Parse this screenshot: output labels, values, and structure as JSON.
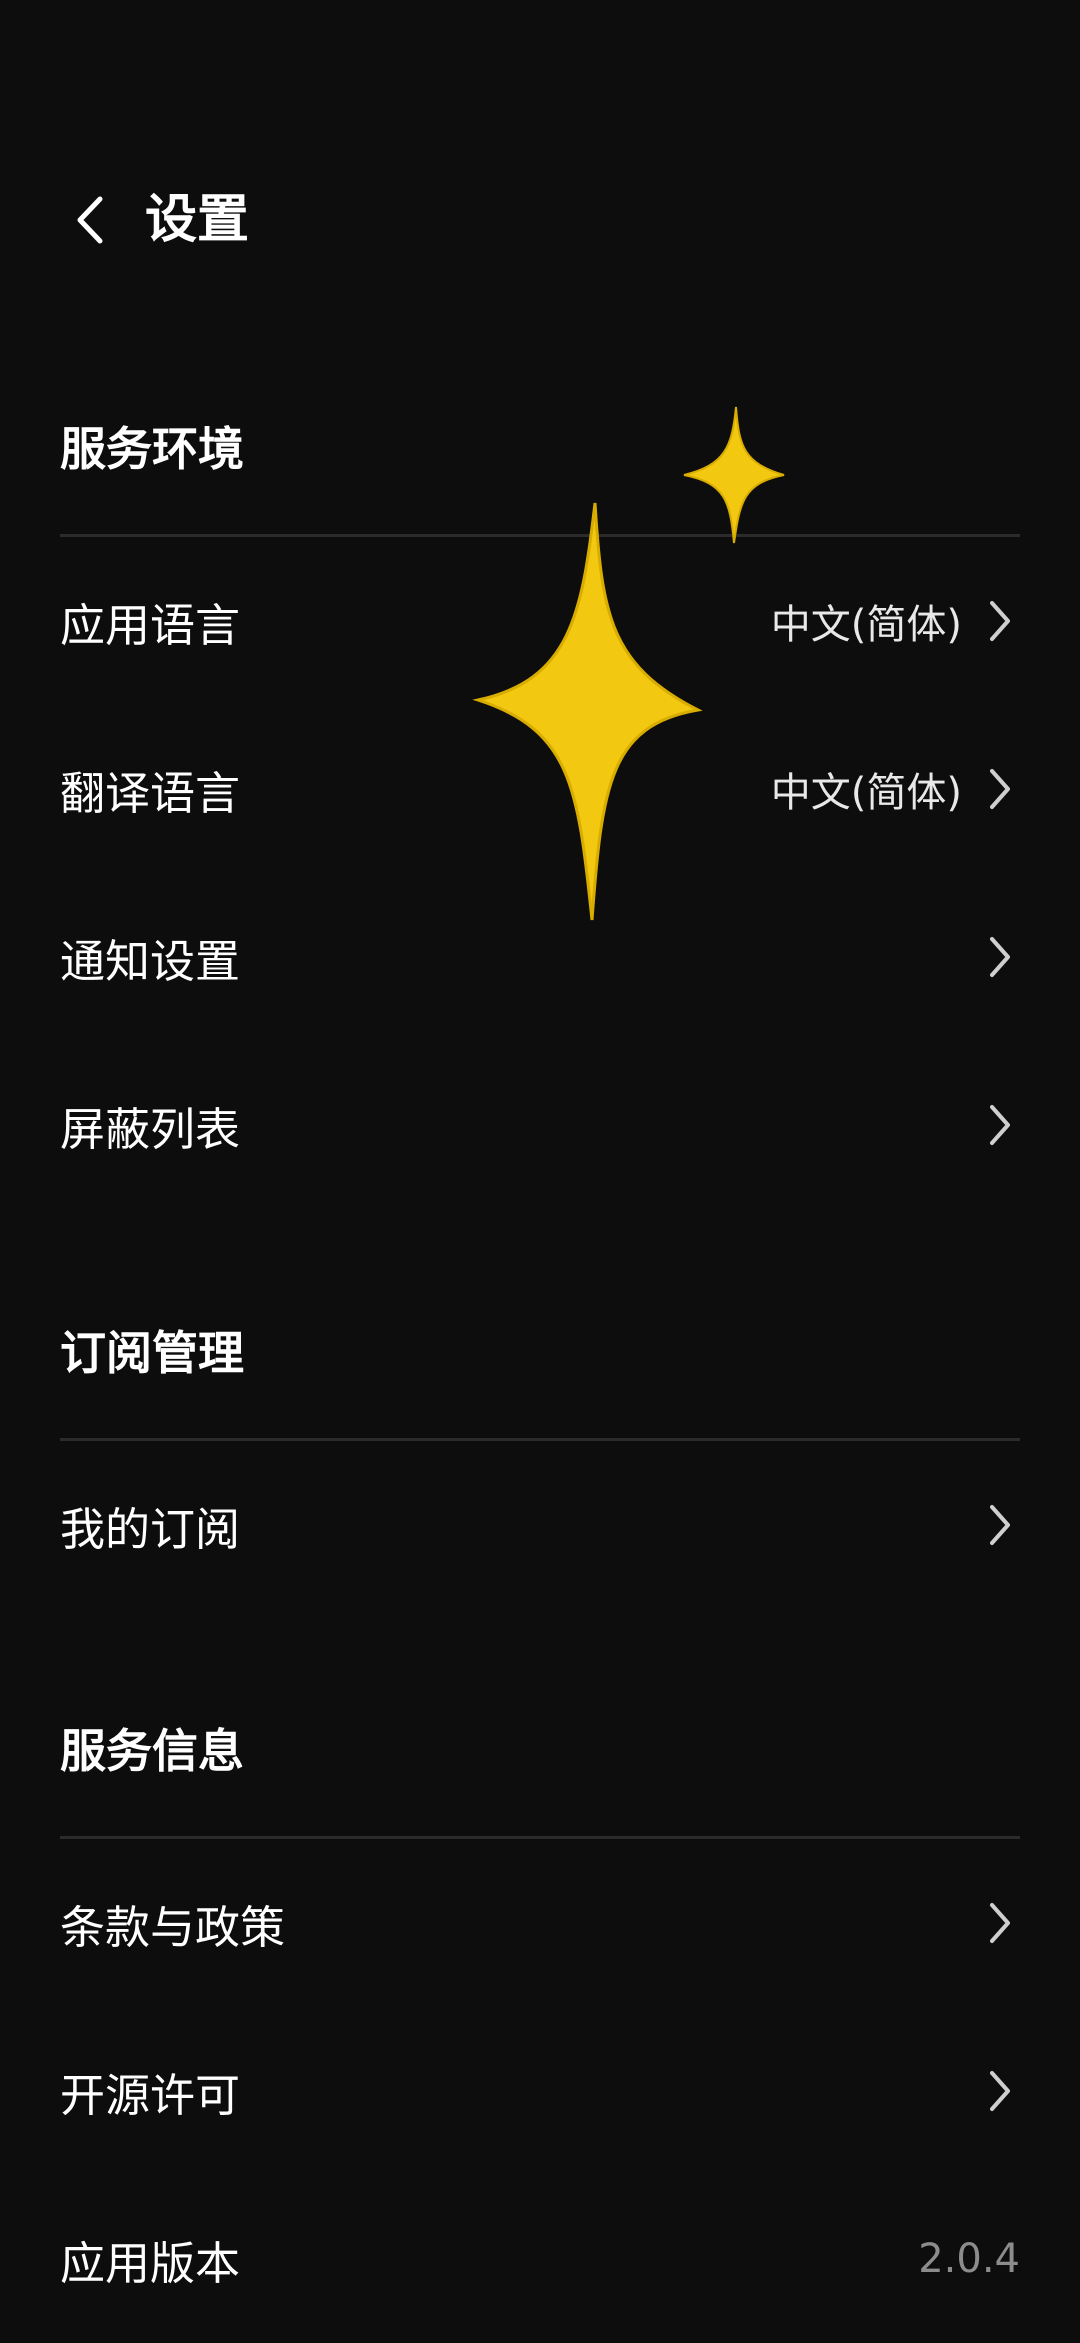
{
  "header": {
    "back_icon": "chevron-left-icon",
    "title": "设置"
  },
  "sections": [
    {
      "title": "服务环境",
      "items": [
        {
          "label": "应用语言",
          "value": "中文(简体)"
        },
        {
          "label": "翻译语言",
          "value": "中文(简体)"
        },
        {
          "label": "通知设置",
          "value": ""
        },
        {
          "label": "屏蔽列表",
          "value": ""
        }
      ]
    },
    {
      "title": "订阅管理",
      "items": [
        {
          "label": "我的订阅",
          "value": ""
        }
      ]
    },
    {
      "title": "服务信息",
      "items": [
        {
          "label": "条款与政策",
          "value": ""
        },
        {
          "label": "开源许可",
          "value": ""
        },
        {
          "label": "应用版本",
          "value": "2.0.4"
        }
      ]
    }
  ],
  "colors": {
    "background": "#0d0d0d",
    "divider": "#2b2b2b",
    "muted_text": "#8c8c8c",
    "sparkle": "#f2c811"
  }
}
